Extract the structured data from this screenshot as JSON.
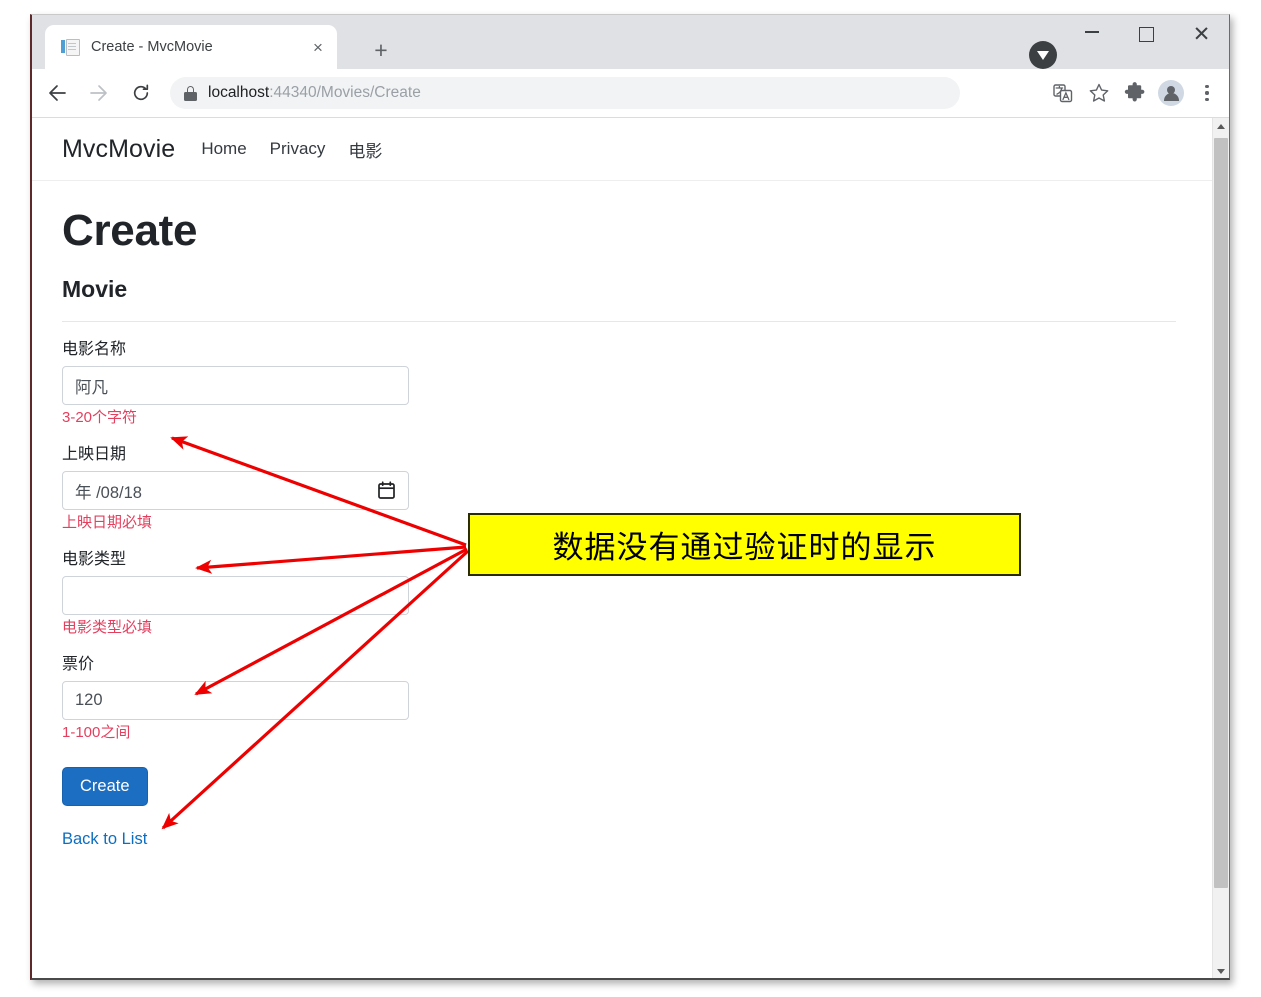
{
  "browser": {
    "tab": {
      "title": "Create - MvcMovie",
      "favicon": "page-icon",
      "close_label": "×"
    },
    "new_tab_label": "+",
    "window_controls": {
      "minimize": "–",
      "maximize": "□",
      "close": "✕"
    },
    "nav": {
      "back": "←",
      "forward": "→",
      "reload": "⟳"
    },
    "omnibox": {
      "lock_icon": "lock-icon",
      "host": "localhost",
      "path": ":44340/Movies/Create",
      "full_url": "localhost:44340/Movies/Create"
    },
    "toolbar_icons": [
      "translate-icon",
      "bookmark-star-icon",
      "extensions-puzzle-icon",
      "profile-avatar-icon",
      "three-dot-menu-icon"
    ]
  },
  "site": {
    "brand": "MvcMovie",
    "nav_links": [
      {
        "label": "Home"
      },
      {
        "label": "Privacy"
      },
      {
        "label": "电影"
      }
    ]
  },
  "page": {
    "title": "Create",
    "subtitle": "Movie",
    "form": {
      "fields": [
        {
          "label": "电影名称",
          "value": "阿凡",
          "placeholder": "",
          "type": "text",
          "error": "3-20个字符"
        },
        {
          "label": "上映日期",
          "value": "年 /08/18",
          "placeholder": "年/月/日",
          "type": "date",
          "error": "上映日期必填"
        },
        {
          "label": "电影类型",
          "value": "",
          "placeholder": "",
          "type": "text",
          "error": "电影类型必填"
        },
        {
          "label": "票价",
          "value": "120",
          "placeholder": "",
          "type": "text",
          "error": "1-100之间"
        }
      ],
      "submit_label": "Create",
      "back_link_label": "Back to List"
    }
  },
  "annotation": {
    "text": "数据没有通过验证时的显示",
    "box_color": "#ffff00",
    "arrow_color": "#ee0000"
  },
  "colors": {
    "accent": "#1b6ec2",
    "error": "#e3405f",
    "link": "#0d6ebf",
    "annotation_bg": "#ffff00",
    "annotation_arrow": "#ee0000"
  }
}
